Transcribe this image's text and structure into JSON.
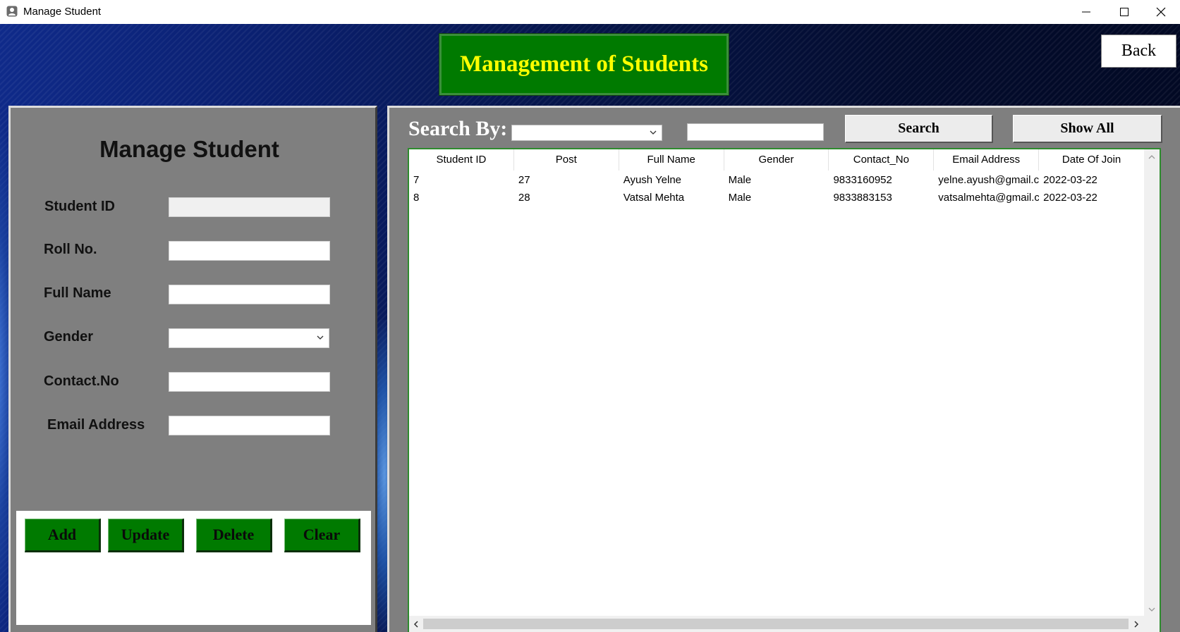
{
  "window": {
    "title": "Manage Student",
    "controls": [
      "minimize-icon",
      "maximize-icon",
      "close-icon"
    ]
  },
  "header": {
    "banner_title": "Management of Students",
    "back_label": "Back"
  },
  "form": {
    "heading": "Manage Student",
    "fields": {
      "student_id": {
        "label": "Student ID",
        "value": ""
      },
      "roll_no": {
        "label": "Roll No.",
        "value": ""
      },
      "full_name": {
        "label": "Full Name",
        "value": ""
      },
      "gender": {
        "label": "Gender",
        "value": ""
      },
      "contact_no": {
        "label": "Contact.No",
        "value": ""
      },
      "email": {
        "label": "Email Address",
        "value": ""
      }
    },
    "buttons": {
      "add": "Add",
      "update": "Update",
      "delete": "Delete",
      "clear": "Clear"
    }
  },
  "search": {
    "label": "Search By:",
    "by_value": "",
    "text_value": "",
    "search_label": "Search",
    "show_all_label": "Show All"
  },
  "table": {
    "columns": [
      "Student ID",
      "Post",
      "Full Name",
      "Gender",
      "Contact_No",
      "Email Address",
      "Date Of Join"
    ],
    "rows": [
      [
        "7",
        "27",
        "Ayush Yelne",
        "Male",
        "9833160952",
        "yelne.ayush@gmail.c",
        "2022-03-22"
      ],
      [
        "8",
        "28",
        "Vatsal Mehta",
        "Male",
        "9833883153",
        "vatsalmehta@gmail.c",
        "2022-03-22"
      ]
    ]
  },
  "colors": {
    "banner_bg": "#007a00",
    "banner_text": "#ffff00",
    "panel_bg": "#7f7f7f",
    "button_green": "#007a00",
    "table_border": "#2e8b2e"
  }
}
